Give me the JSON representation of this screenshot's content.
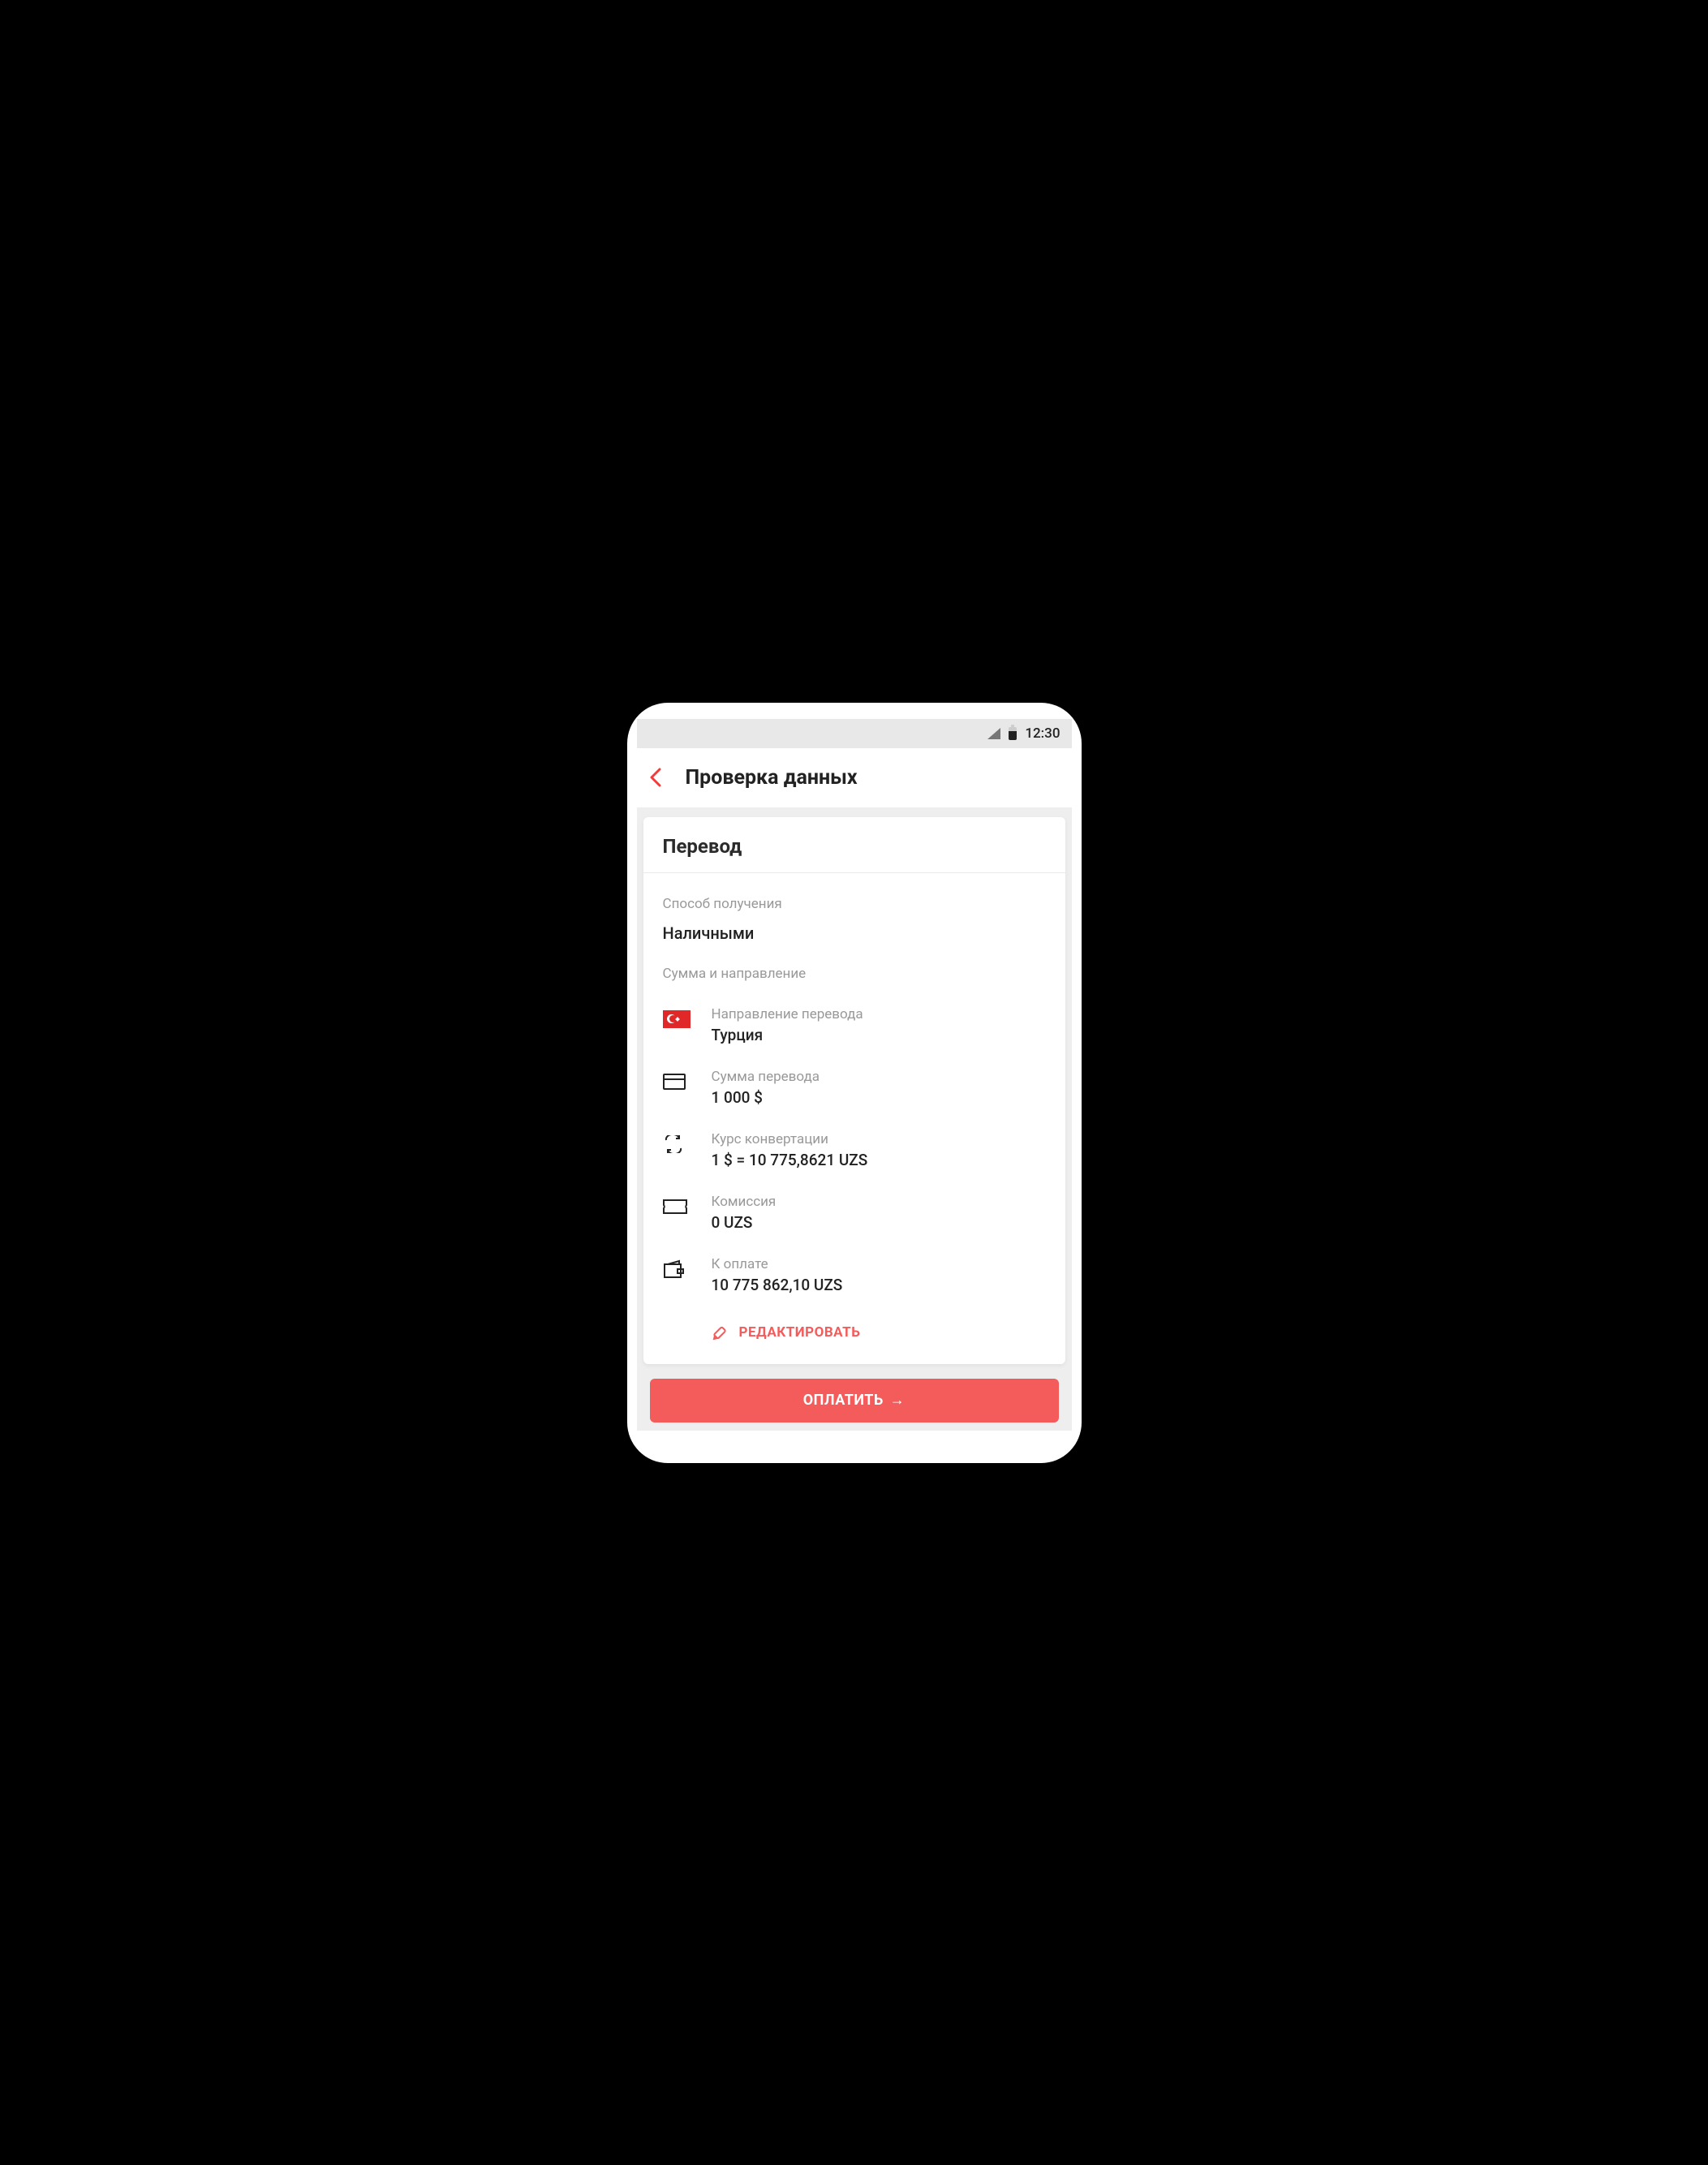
{
  "status": {
    "time": "12:30"
  },
  "header": {
    "title": "Проверка данных"
  },
  "card": {
    "title": "Перевод",
    "method": {
      "label": "Способ получения",
      "value": "Наличными"
    },
    "amount_section_label": "Сумма и направление",
    "rows": {
      "direction": {
        "label": "Направление перевода",
        "value": "Турция"
      },
      "amount": {
        "label": "Сумма перевода",
        "value": "1 000 $"
      },
      "rate": {
        "label": "Курс конвертации",
        "value": "1 $ = 10 775,8621 UZS"
      },
      "fee": {
        "label": "Комиссия",
        "value": "0 UZS"
      },
      "total": {
        "label": "К оплате",
        "value": "10 775 862,10 UZS"
      }
    },
    "edit_label": "РЕДАКТИРОВАТЬ"
  },
  "pay_button": "ОПЛАТИТЬ"
}
